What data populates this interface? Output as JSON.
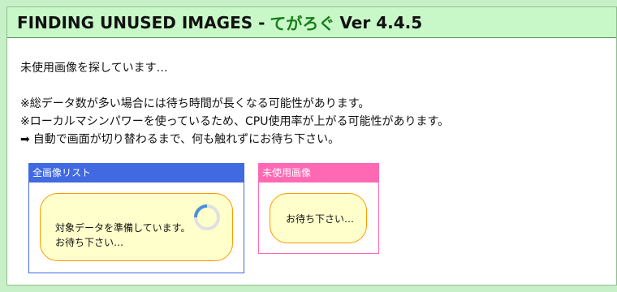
{
  "header": {
    "title_prefix": "FINDING UNUSED IMAGES -",
    "brand": "てがろぐ",
    "version": "Ver 4.4.5"
  },
  "main": {
    "loading_message": "未使用画像を探しています…",
    "notes": [
      "※総データ数が多い場合には待ち時間が長くなる可能性があります。",
      "※ローカルマシンパワーを使っているため、CPU使用率が上がる可能性があります。",
      "自動で画面が切り替わるまで、何も触れずにお待ち下さい。"
    ],
    "arrow_icon": "➡"
  },
  "panels": {
    "all_images": {
      "header": "全画像リスト",
      "message_line1": "対象データを準備しています。",
      "message_line2": "お待ち下さい…"
    },
    "unused_images": {
      "header": "未使用画像",
      "message": "お待ち下さい…"
    }
  },
  "colors": {
    "page_bg": "#c8f0c8",
    "title_bg": "#c8f8c8",
    "brand": "#1a7a1a",
    "all_panel": "#4169e1",
    "unused_panel": "#ff69b4",
    "bubble_bg": "#ffffcc",
    "bubble_border": "#ff9900",
    "spinner": "#4a90d9"
  }
}
